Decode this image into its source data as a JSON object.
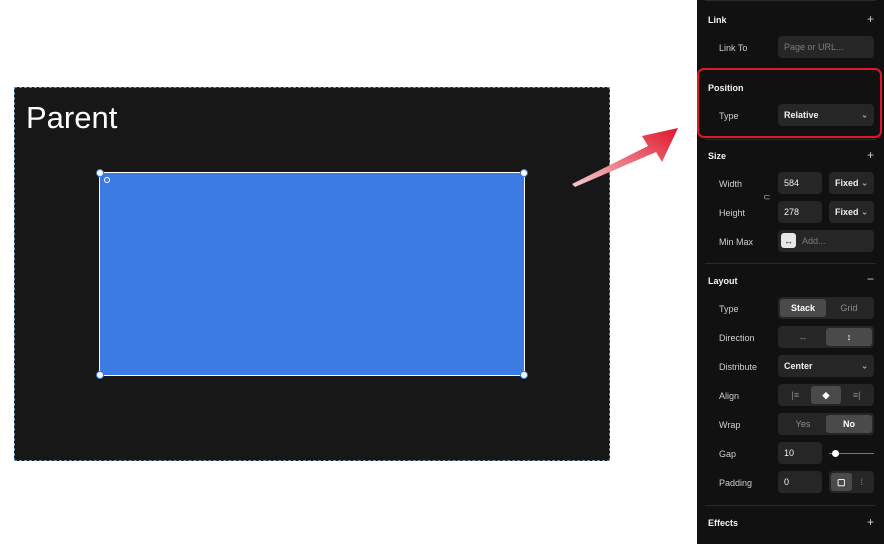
{
  "canvas": {
    "parent_label": "Parent",
    "parent_bg": "#171717",
    "child_color": "#3b7be3"
  },
  "panel": {
    "link": {
      "title": "Link",
      "link_to_label": "Link To",
      "link_to_placeholder": "Page or URL..."
    },
    "position": {
      "title": "Position",
      "type_label": "Type",
      "type_value": "Relative"
    },
    "size": {
      "title": "Size",
      "width_label": "Width",
      "width_value": "584",
      "width_mode": "Fixed",
      "height_label": "Height",
      "height_value": "278",
      "height_mode": "Fixed",
      "minmax_label": "Min Max",
      "minmax_placeholder": "Add..."
    },
    "layout": {
      "title": "Layout",
      "type_label": "Type",
      "type_options": [
        "Stack",
        "Grid"
      ],
      "type_selected": "Stack",
      "direction_label": "Direction",
      "distribute_label": "Distribute",
      "distribute_value": "Center",
      "align_label": "Align",
      "wrap_label": "Wrap",
      "wrap_options": [
        "Yes",
        "No"
      ],
      "wrap_selected": "No",
      "gap_label": "Gap",
      "gap_value": "10",
      "padding_label": "Padding",
      "padding_value": "0"
    },
    "effects": {
      "title": "Effects"
    },
    "highlight_color": "#e0162b"
  }
}
